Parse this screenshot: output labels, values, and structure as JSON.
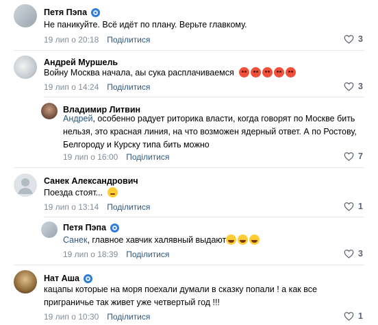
{
  "comments": [
    {
      "author": "Петя Пэпа",
      "verified": true,
      "text": "Не паникуйте. Всё идёт по плану. Верьте главкому.",
      "date": "19 лип о 20:18",
      "reply": "Поділитися",
      "likes": "3"
    },
    {
      "author": "Андрей Муршель",
      "verified": false,
      "text": "Войну Москва начала, аы сука расплачиваемся",
      "emoji": [
        "angry-face",
        "angry-face",
        "angry-face",
        "angry-face",
        "angry-face"
      ],
      "date": "19 лип о 14:24",
      "reply": "Поділитися",
      "likes": "3"
    },
    {
      "author": "Владимир Литвин",
      "verified": false,
      "mention": "Андрей",
      "text": ", особенно радует риторика власти, когда говорят по Москве бить нельзя, это красная линия, на что возможен ядерный ответ. А по Ростову, Белгороду и Курску типа бить можно",
      "date": "19 лип о 16:00",
      "reply": "Поділитися",
      "likes": "7"
    },
    {
      "author": "Санек Александрович",
      "verified": false,
      "text": "Поезда стоят...",
      "emoji": [
        "pensive-face"
      ],
      "date": "19 лип о 13:14",
      "reply": "Поділитися",
      "likes": "1"
    },
    {
      "author": "Петя Пэпа",
      "verified": true,
      "mention": "Санек",
      "text": ", главное хавчик халявный выдают",
      "emoji": [
        "laughing-face",
        "laughing-face",
        "laughing-face"
      ],
      "date": "19 лип о 18:39",
      "reply": "Поділитися",
      "likes": "3"
    },
    {
      "author": "Нат Аша",
      "verified": true,
      "text": "кацапы которые на моря поехали думали в сказку попали ! а как все приграничье так живет уже четвертый год !!!",
      "date": "19 лип о 10:30",
      "reply": "Поділитися",
      "likes": "1"
    }
  ]
}
